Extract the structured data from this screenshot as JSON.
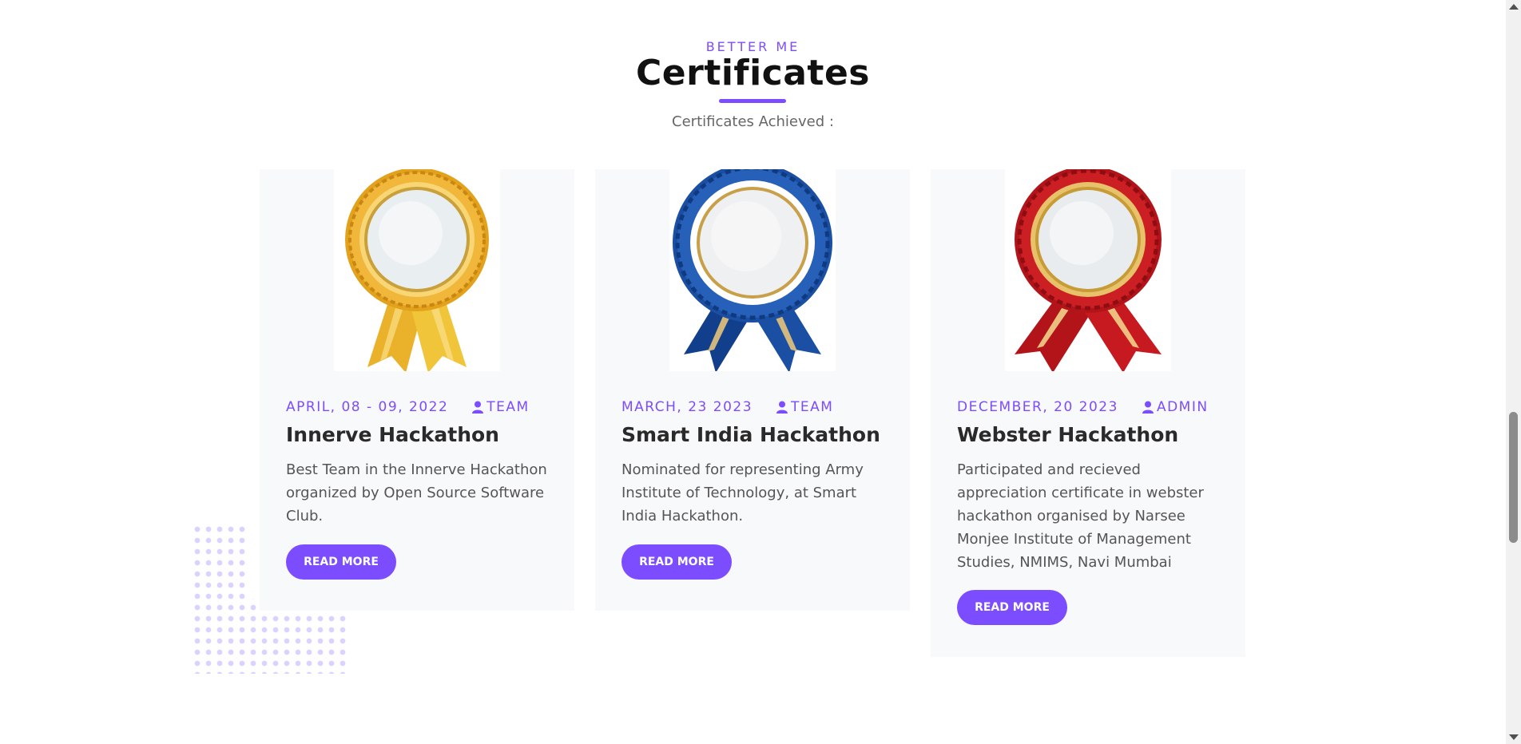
{
  "section": {
    "eyebrow": "BETTER ME",
    "title": "Certificates",
    "subtitle": "Certificates Achieved :"
  },
  "cards": [
    {
      "date": "APRIL, 08 - 09, 2022",
      "author": "TEAM",
      "title": "Innerve Hackathon",
      "text": "Best Team in the Innerve Hackathon organized by Open Source Software Club.",
      "button": "READ MORE",
      "badge_color": "gold"
    },
    {
      "date": "MARCH, 23 2023",
      "author": "TEAM",
      "title": "Smart India Hackathon",
      "text": "Nominated for representing Army Institute of Technology, at Smart India Hackathon.",
      "button": "READ MORE",
      "badge_color": "blue"
    },
    {
      "date": "DECEMBER, 20 2023",
      "author": "ADMIN",
      "title": "Webster Hackathon",
      "text": "Participated and recieved appreciation certificate in webster hackathon organised by Narsee Monjee Institute of Management Studies, NMIMS, Navi Mumbai",
      "button": "READ MORE",
      "badge_color": "red"
    }
  ],
  "colors": {
    "accent": "#7c4dff",
    "card_bg": "#f8f9fa"
  },
  "icons": {
    "author": "user-icon",
    "badge": "award-ribbon-icon"
  }
}
